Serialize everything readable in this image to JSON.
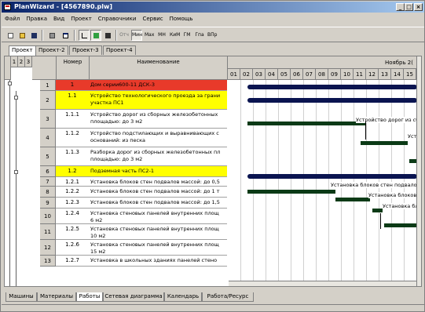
{
  "window": {
    "title": "PlanWizard - [4567890.plw]"
  },
  "menu": [
    "Файл",
    "Правка",
    "Вид",
    "Проект",
    "Справочники",
    "Сервис",
    "Помощь"
  ],
  "toolbar": {
    "text_buttons": [
      "Отч",
      "Мин",
      "Мах",
      "МН",
      "КиМ",
      "ГМ",
      "Гпа",
      "ВПр"
    ]
  },
  "top_tabs": [
    "Проект",
    "Проект-2",
    "Проект-3",
    "Проект-4"
  ],
  "table": {
    "level_headers": [
      "1",
      "2",
      "3"
    ],
    "col_number": "Номер",
    "col_name": "Наименование",
    "rows": [
      {
        "n": "1",
        "code": "1",
        "name": "Дом серии600-11 ДСК-3",
        "style": "red"
      },
      {
        "n": "2",
        "code": "1.1",
        "name": "Устройство технологического проезда за грани",
        "name2": "участка ПС1",
        "style": "yellow"
      },
      {
        "n": "3",
        "code": "1.1.1",
        "name": "Устройство дорог из сборных железобетонных",
        "name2": "площадью: до 3 м2",
        "style": ""
      },
      {
        "n": "4",
        "code": "1.1.2",
        "name": "Устройство подстилающих и выравнивающих с",
        "name2": "оснований: из песка",
        "style": ""
      },
      {
        "n": "5",
        "code": "1.1.3",
        "name": "Разборка дорог из сборных железобетонных пл",
        "name2": "площадью: до 3 м2",
        "style": ""
      },
      {
        "n": "6",
        "code": "1.2",
        "name": "Подземная часть ПС2-1",
        "style": "yellow"
      },
      {
        "n": "7",
        "code": "1.2.1",
        "name": "Установка блоков стен подвалов массой: до 0,5",
        "style": ""
      },
      {
        "n": "8",
        "code": "1.2.2",
        "name": "Установка блоков стен подвалов массой: до 1 т",
        "style": ""
      },
      {
        "n": "9",
        "code": "1.2.3",
        "name": "Установка блоков стен подвалов массой: до 1,5",
        "style": ""
      },
      {
        "n": "10",
        "code": "1.2.4",
        "name": "Установка стеновых панелей внутренних площ",
        "name2": "6 м2",
        "style": ""
      },
      {
        "n": "11",
        "code": "1.2.5",
        "name": "Установка стеновых панелей внутренних площ",
        "name2": "10 м2",
        "style": ""
      },
      {
        "n": "12",
        "code": "1.2.6",
        "name": "Установка стеновых панелей внутренних площ",
        "name2": "15 м2",
        "style": ""
      },
      {
        "n": "13",
        "code": "1.2.7",
        "name": "Установка в школьных зданиях панелей стено",
        "style": ""
      }
    ]
  },
  "gantt": {
    "month": "Ноябрь 2(",
    "days": [
      "01",
      "02",
      "03",
      "04",
      "05",
      "06",
      "07",
      "08",
      "09",
      "10",
      "11",
      "12",
      "13",
      "14",
      "15"
    ],
    "labels": {
      "r3": "Устройство дорог из сб",
      "r4": "Устро",
      "r7": "Установка блоков стен подвало",
      "r8": "Установка блоков с",
      "r9": "Установка блок"
    }
  },
  "bottom_tabs": [
    "Машины",
    "Материалы",
    "Работы",
    "Сетевая диаграмма",
    "Календарь",
    "Работа/Ресурс"
  ]
}
